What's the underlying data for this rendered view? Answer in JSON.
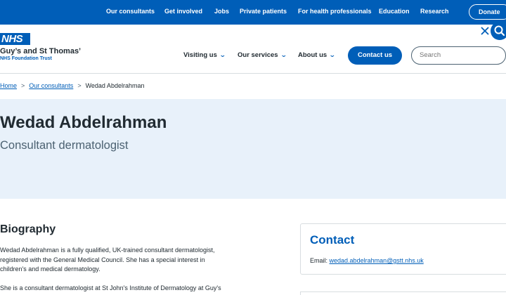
{
  "topbar": {
    "links": [
      "Our consultants",
      "Get involved",
      "Jobs",
      "Private patients",
      "For health professionals",
      "Education",
      "Research"
    ],
    "donate": "Donate"
  },
  "header": {
    "logo_text": "NHS",
    "trust_name": "Guy’s and St Thomas’",
    "trust_sub": "NHS Foundation Trust",
    "nav": [
      "Visiting us",
      "Our services",
      "About us"
    ],
    "contact_button": "Contact us",
    "search_placeholder": "Search"
  },
  "breadcrumb": {
    "home": "Home",
    "consultants": "Our consultants",
    "current": "Wedad Abdelrahman"
  },
  "hero": {
    "name": "Wedad Abdelrahman",
    "role": "Consultant dermatologist"
  },
  "biography": {
    "title": "Biography",
    "p1_lines": [
      "Wedad Abdelrahman is a fully qualified, UK-trained consultant dermatologist,",
      "registered with the General Medical Council. She has a special interest in",
      "children's and medical dermatology."
    ],
    "p2_line": "She is a consultant dermatologist at St John's Institute of Dermatology at Guy's"
  },
  "contact": {
    "title": "Contact",
    "email_label": "Email:",
    "email": "wedad.abdelrahman@gstt.nhs.uk"
  },
  "colors": {
    "nhs_blue": "#005eb8",
    "hero_bg": "#e8f1fa",
    "text": "#212b32",
    "secondary_text": "#4c6272"
  }
}
